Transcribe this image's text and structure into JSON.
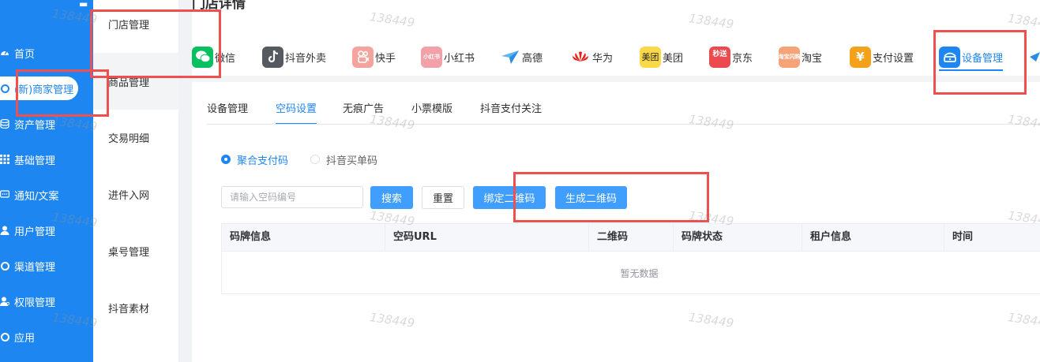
{
  "sidebar": {
    "items": [
      {
        "label": "首页",
        "icon": "dashboard-icon"
      },
      {
        "label": "(新)商家管理",
        "icon": "circle-icon",
        "active": true
      },
      {
        "label": "资产管理",
        "icon": "database-icon"
      },
      {
        "label": "基础管理",
        "icon": "grid-icon"
      },
      {
        "label": "通知/文案",
        "icon": "message-icon"
      },
      {
        "label": "用户管理",
        "icon": "user-icon"
      },
      {
        "label": "渠道管理",
        "icon": "circle-icon"
      },
      {
        "label": "权限管理",
        "icon": "shield-user-icon"
      },
      {
        "label": "应用",
        "icon": "circle-icon"
      }
    ]
  },
  "subnav": {
    "items": [
      {
        "label": "门店管理"
      },
      {
        "label": "商品管理"
      },
      {
        "label": "交易明细"
      },
      {
        "label": "进件入网"
      },
      {
        "label": "桌号管理"
      },
      {
        "label": "抖音素材"
      }
    ]
  },
  "page": {
    "title": "门店详情"
  },
  "platforms": [
    {
      "label": "微信",
      "icon": "wechat-icon",
      "icon_text": "",
      "color": "#07c160"
    },
    {
      "label": "抖音外卖",
      "icon": "douyin-icon",
      "icon_text": "",
      "color": "#555a61"
    },
    {
      "label": "快手",
      "icon": "kuaishou-icon",
      "icon_text": "",
      "color": "#f4a49c"
    },
    {
      "label": "小红书",
      "icon": "xiaohongshu-icon",
      "icon_text": "小红书",
      "color": "#f3a0a8"
    },
    {
      "label": "高德",
      "icon": "amap-icon",
      "icon_text": "",
      "color": "#ffffff"
    },
    {
      "label": "华为",
      "icon": "huawei-icon",
      "icon_text": "HUAWEI",
      "color": "#ffffff"
    },
    {
      "label": "美团",
      "icon": "meituan-icon",
      "icon_text": "美团",
      "color": "#f9d84a"
    },
    {
      "label": "京东",
      "icon": "jd-icon",
      "icon_text": "秒送",
      "color": "#ec4a4f"
    },
    {
      "label": "淘宝",
      "icon": "taobao-icon",
      "icon_text": "淘宝闪购",
      "color": "#f7a37a"
    },
    {
      "label": "支付设置",
      "icon": "payment-settings-icon",
      "icon_text": "¥",
      "color": "#f4a21c"
    },
    {
      "label": "设备管理",
      "icon": "device-icon",
      "icon_text": "",
      "color": "#1e86f0",
      "active": true
    }
  ],
  "tabs": [
    {
      "label": "设备管理"
    },
    {
      "label": "空码设置",
      "active": true
    },
    {
      "label": "无痕广告"
    },
    {
      "label": "小票模版"
    },
    {
      "label": "抖音支付关注"
    }
  ],
  "radios": [
    {
      "label": "聚合支付码",
      "checked": true
    },
    {
      "label": "抖音买单码",
      "checked": false
    }
  ],
  "search": {
    "placeholder": "请输入空码编号",
    "value": ""
  },
  "buttons": {
    "search": "搜索",
    "reset": "重置",
    "bind_qr": "绑定二维码",
    "generate_qr": "生成二维码"
  },
  "table": {
    "columns": [
      "码牌信息",
      "空码URL",
      "二维码",
      "码牌状态",
      "租户信息",
      "时间"
    ],
    "empty_text": "暂无数据"
  },
  "watermark": {
    "text": "138449"
  },
  "colors": {
    "sidebar": "#1e86f0",
    "primary": "#409eff",
    "annotation": "#ee5050"
  }
}
